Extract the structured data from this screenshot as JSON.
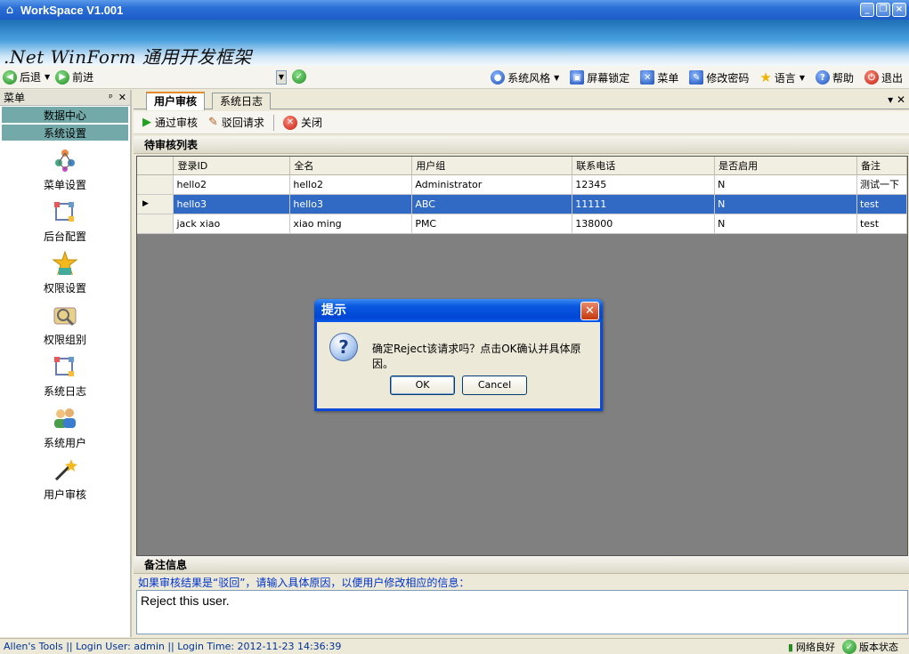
{
  "window": {
    "title": "WorkSpace  V1.001",
    "banner": ".Net WinForm 通用开发框架"
  },
  "nav": {
    "back": "后退",
    "forward": "前进"
  },
  "toolbar": {
    "style": "系统风格",
    "lock": "屏幕锁定",
    "menu": "菜单",
    "password": "修改密码",
    "language": "语言",
    "help": "帮助",
    "exit": "退出"
  },
  "sidebar": {
    "title": "菜单",
    "groups": [
      "数据中心",
      "系统设置"
    ],
    "items": [
      {
        "label": "菜单设置",
        "icon": "menu-settings-icon"
      },
      {
        "label": "后台配置",
        "icon": "backend-config-icon"
      },
      {
        "label": "权限设置",
        "icon": "permission-icon"
      },
      {
        "label": "权限组别",
        "icon": "permission-group-icon"
      },
      {
        "label": "系统日志",
        "icon": "system-log-icon"
      },
      {
        "label": "系统用户",
        "icon": "system-users-icon"
      },
      {
        "label": "用户审核",
        "icon": "user-review-icon"
      }
    ]
  },
  "tabs": [
    {
      "label": "用户审核"
    },
    {
      "label": "系统日志"
    }
  ],
  "actions": {
    "approve": "通过审核",
    "reject": "驳回请求",
    "close": "关闭"
  },
  "list": {
    "title": "待审核列表",
    "columns": [
      "登录ID",
      "全名",
      "用户组",
      "联系电话",
      "是否启用",
      "备注"
    ],
    "rows": [
      [
        "hello2",
        "hello2",
        "Administrator",
        "12345",
        "N",
        "测试一下"
      ],
      [
        "hello3",
        "hello3",
        "ABC",
        "11111",
        "N",
        "test"
      ],
      [
        "jack xiao",
        "xiao ming",
        "PMC",
        "138000",
        "N",
        "test"
      ]
    ],
    "selected_row": 1
  },
  "notes": {
    "title": "备注信息",
    "hint": "如果审核结果是“驳回”，请输入具体原因，以便用户修改相应的信息：",
    "value": "Reject this user."
  },
  "dialog": {
    "title": "提示",
    "message": "确定Reject该请求吗？点击OK确认并具体原因。",
    "ok": "OK",
    "cancel": "Cancel"
  },
  "status": {
    "left": "Allen's Tools  ||  Login User: admin  ||  Login Time: 2012-11-23 14:36:39",
    "network": "网络良好",
    "version": "版本状态"
  }
}
